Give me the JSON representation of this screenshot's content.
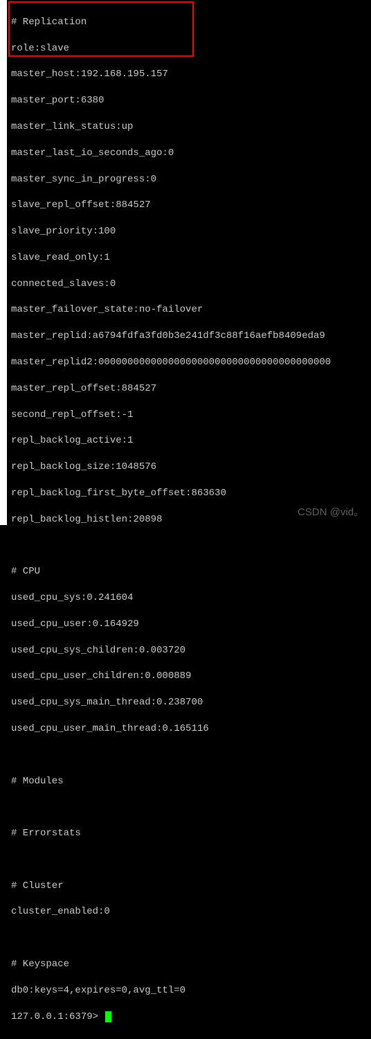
{
  "replication": {
    "header": "# Replication",
    "role": "role:slave",
    "master_host": "master_host:192.168.195.157",
    "master_port": "master_port:6380",
    "master_link_status": "master_link_status:up",
    "master_last_io_seconds_ago": "master_last_io_seconds_ago:0",
    "master_sync_in_progress": "master_sync_in_progress:0",
    "slave_repl_offset": "slave_repl_offset:884527",
    "slave_priority": "slave_priority:100",
    "slave_read_only": "slave_read_only:1",
    "connected_slaves": "connected_slaves:0",
    "master_failover_state": "master_failover_state:no-failover",
    "master_replid": "master_replid:a6794fdfa3fd0b3e241df3c88f16aefb8409eda9",
    "master_replid2": "master_replid2:0000000000000000000000000000000000000000",
    "master_repl_offset": "master_repl_offset:884527",
    "second_repl_offset": "second_repl_offset:-1",
    "repl_backlog_active": "repl_backlog_active:1",
    "repl_backlog_size": "repl_backlog_size:1048576",
    "repl_backlog_first_byte_offset": "repl_backlog_first_byte_offset:863630",
    "repl_backlog_histlen": "repl_backlog_histlen:20898"
  },
  "cpu": {
    "header": "# CPU",
    "used_cpu_sys": "used_cpu_sys:0.241604",
    "used_cpu_user": "used_cpu_user:0.164929",
    "used_cpu_sys_children": "used_cpu_sys_children:0.003720",
    "used_cpu_user_children": "used_cpu_user_children:0.000889",
    "used_cpu_sys_main_thread": "used_cpu_sys_main_thread:0.238700",
    "used_cpu_user_main_thread": "used_cpu_user_main_thread:0.165116"
  },
  "modules": {
    "header": "# Modules"
  },
  "errorstats": {
    "header": "# Errorstats"
  },
  "cluster": {
    "header": "# Cluster",
    "cluster_enabled": "cluster_enabled:0"
  },
  "keyspace": {
    "header": "# Keyspace",
    "db0": "db0:keys=4,expires=0,avg_ttl=0"
  },
  "prompt": "127.0.0.1:6379> ",
  "watermark": "CSDN @vid。"
}
